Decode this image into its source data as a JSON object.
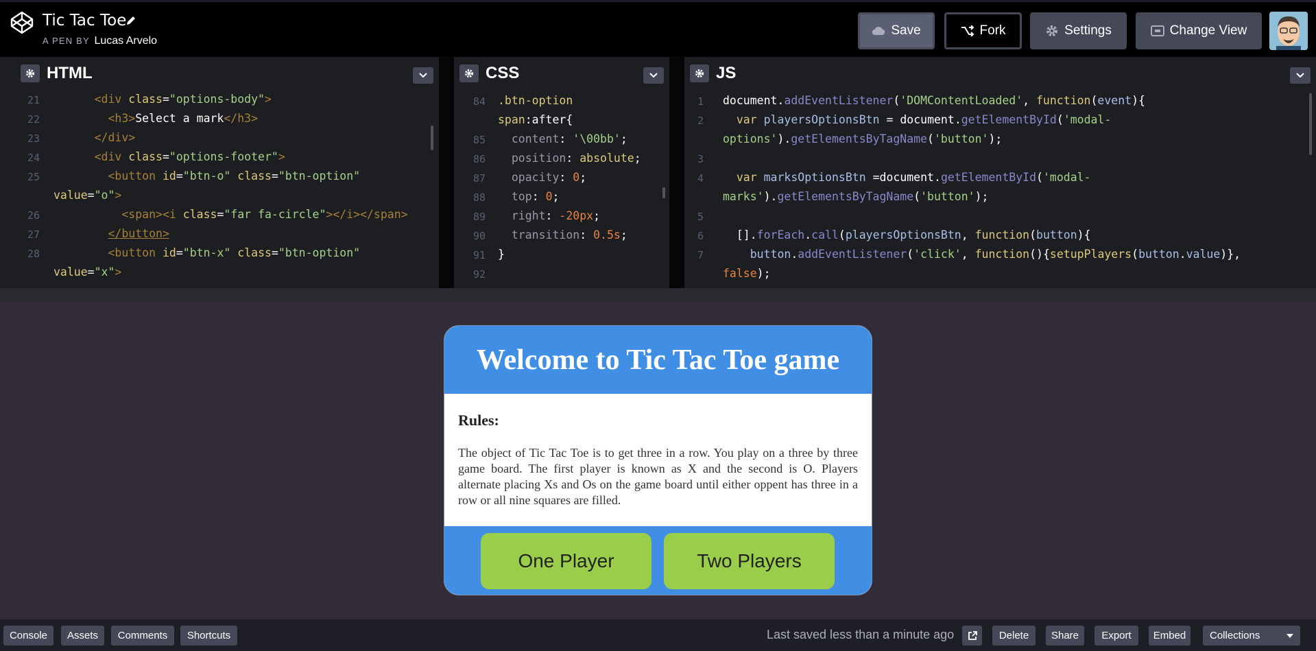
{
  "header": {
    "title": "Tic Tac Toe",
    "pen_by_label": "A PEN BY",
    "author": "Lucas Arvelo",
    "buttons": {
      "save": "Save",
      "fork": "Fork",
      "settings": "Settings",
      "change_view": "Change View"
    }
  },
  "editors": {
    "html": {
      "label": "HTML",
      "lines": [
        {
          "n": "21",
          "html": "      <span class='tg'>&lt;div</span> <span class='at'>class</span>=<span class='st'>\"options-body\"</span><span class='tg'>&gt;</span>"
        },
        {
          "n": "22",
          "html": "        <span class='tg'>&lt;h3&gt;</span>Select a mark<span class='tg'>&lt;/h3&gt;</span>"
        },
        {
          "n": "23",
          "html": "      <span class='tg'>&lt;/div&gt;</span>"
        },
        {
          "n": "24",
          "html": "      <span class='tg'>&lt;div</span> <span class='at'>class</span>=<span class='st'>\"options-footer\"</span><span class='tg'>&gt;</span>"
        },
        {
          "n": "25",
          "html": "        <span class='tg'>&lt;button</span> <span class='at'>id</span>=<span class='st'>\"btn-o\"</span> <span class='at'>class</span>=<span class='st'>\"btn-option\"</span>"
        },
        {
          "n": "",
          "html": "<span class='at'>value</span>=<span class='st'>\"o\"</span><span class='tg'>&gt;</span>"
        },
        {
          "n": "26",
          "html": "          <span class='tg'>&lt;span&gt;&lt;i</span> <span class='at'>class</span>=<span class='st'>\"far fa-circle\"</span><span class='tg'>&gt;&lt;/i&gt;&lt;/span&gt;</span>"
        },
        {
          "n": "27",
          "html": "        <span class='tg' style='text-decoration:underline'>&lt;/button&gt;</span>"
        },
        {
          "n": "28",
          "html": "        <span class='tg'>&lt;button</span> <span class='at'>id</span>=<span class='st'>\"btn-x\"</span> <span class='at'>class</span>=<span class='st'>\"btn-option\"</span>"
        },
        {
          "n": "",
          "html": "<span class='at'>value</span>=<span class='st'>\"x\"</span><span class='tg'>&gt;</span>"
        }
      ]
    },
    "css": {
      "label": "CSS",
      "lines": [
        {
          "n": "84",
          "html": "<span class='sel'>.btn-option</span>"
        },
        {
          "n": "",
          "html": "<span class='sel'>span</span>:after{"
        },
        {
          "n": "85",
          "html": "  <span class='prop'>content</span>: <span class='stj'>'\\00bb'</span>;"
        },
        {
          "n": "86",
          "html": "  <span class='prop'>position</span>: <span class='val'>absolute</span>;"
        },
        {
          "n": "87",
          "html": "  <span class='prop'>opacity</span>: <span class='num'>0</span>;"
        },
        {
          "n": "88",
          "html": "  <span class='prop'>top</span>: <span class='num'>0</span>;"
        },
        {
          "n": "89",
          "html": "  <span class='prop'>right</span>: <span class='num'>-20px</span>;"
        },
        {
          "n": "90",
          "html": "  <span class='prop'>transition</span>: <span class='num'>0.5s</span>;"
        },
        {
          "n": "91",
          "html": "}"
        },
        {
          "n": "92",
          "html": ""
        }
      ]
    },
    "js": {
      "label": "JS",
      "lines": [
        {
          "n": "1",
          "html": "<span class='pl'>document</span>.<span class='mt'>addEventListener</span>(<span class='stj'>'DOMContentLoaded'</span>, <span class='kw'>function</span>(<span class='vr'>event</span>){"
        },
        {
          "n": "2",
          "html": "  <span class='kw'>var</span> <span class='vr'>playersOptionsBtn</span> = <span class='pl'>document</span>.<span class='mt'>getElementById</span>(<span class='stj'>'modal-</span>"
        },
        {
          "n": "",
          "html": "<span class='stj'>options'</span>).<span class='mt'>getElementsByTagName</span>(<span class='stj'>'button'</span>);"
        },
        {
          "n": "3",
          "html": ""
        },
        {
          "n": "4",
          "html": "  <span class='kw'>var</span> <span class='vr'>marksOptionsBtn</span> =<span class='pl'>document</span>.<span class='mt'>getElementById</span>(<span class='stj'>'modal-</span>"
        },
        {
          "n": "",
          "html": "<span class='stj'>marks'</span>).<span class='mt'>getElementsByTagName</span>(<span class='stj'>'button'</span>);"
        },
        {
          "n": "5",
          "html": ""
        },
        {
          "n": "6",
          "html": "  [].<span class='mt'>forEach</span>.<span class='mt'>call</span>(<span class='vr'>playersOptionsBtn</span>, <span class='kw'>function</span>(<span class='vr'>button</span>){"
        },
        {
          "n": "7",
          "html": "    <span class='vr'>button</span>.<span class='mt'>addEventListener</span>(<span class='stj'>'click'</span>, <span class='kw'>function</span>(){<span class='fn'>setupPlayers</span>(<span class='vr'>button</span>.<span class='vr'>value</span>)},"
        },
        {
          "n": "",
          "html": "<span class='num'>false</span>);"
        }
      ]
    }
  },
  "modal": {
    "title": "Welcome to Tic Tac Toe game",
    "rules_heading": "Rules:",
    "rules_text": "The object of Tic Tac Toe is to get three in a row. You play on a three by three game board. The first player is known as X and the second is O. Players alternate placing Xs and Os on the game board until either oppent has three in a row or all nine squares are filled.",
    "one_player": "One Player",
    "two_players": "Two Players"
  },
  "footer": {
    "console": "Console",
    "assets": "Assets",
    "comments": "Comments",
    "shortcuts": "Shortcuts",
    "saved_status": "Last saved less than a minute ago",
    "delete": "Delete",
    "share": "Share",
    "export": "Export",
    "embed": "Embed",
    "collections": "Collections"
  },
  "colors": {
    "accent_blue": "#418ee5",
    "button_green": "#9acd4a",
    "result_bg": "#322d38"
  }
}
